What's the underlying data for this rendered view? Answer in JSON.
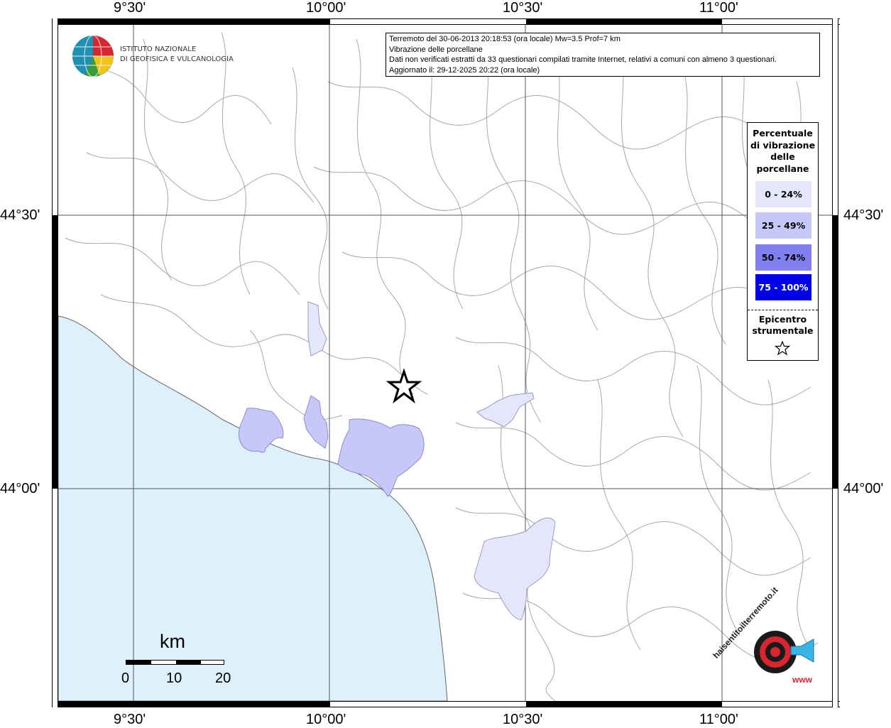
{
  "map": {
    "lon_labels": [
      "9°30'",
      "10°00'",
      "10°30'",
      "11°00'"
    ],
    "lat_labels": [
      "44°30'",
      "44°00'"
    ],
    "sea_color": "#ddf0fb",
    "border_color": "#a8a8a8",
    "epicenter_icon": "star-outline-icon"
  },
  "logo": {
    "line1": "ISTITUTO NAZIONALE",
    "line2": "DI GEOFISICA E VULCANOLOGIA"
  },
  "info": {
    "line1": "Terremoto del 30-06-2013 20:18:53 (ora locale) Mw=3.5 Prof=7 km",
    "line2": "Vibrazione delle porcellane",
    "line3": "Dati non verificati estratti da 33 questionari compilati tramite Internet, relativi a comuni con almeno 3 questionari.",
    "line4": "Aggiornato il: 29-12-2025 20:22 (ora locale)"
  },
  "legend": {
    "title_lines": [
      "Percentuale",
      "di vibrazione",
      "delle",
      "porcellane"
    ],
    "classes": [
      {
        "label": "0 - 24%",
        "color": "#e6e6fa",
        "text_color": "#000000"
      },
      {
        "label": "25 - 49%",
        "color": "#c8c8f8",
        "text_color": "#000000"
      },
      {
        "label": "50 - 74%",
        "color": "#8080f0",
        "text_color": "#000000"
      },
      {
        "label": "75 - 100%",
        "color": "#0000e6",
        "text_color": "#ffffff"
      }
    ],
    "epicenter_lines": [
      "Epicentro",
      "strumentale"
    ]
  },
  "scale": {
    "unit": "km",
    "labels": [
      "0",
      "10",
      "20"
    ]
  },
  "watermark": {
    "text1": "haisentitoilterremoto.it",
    "text2": "www"
  }
}
